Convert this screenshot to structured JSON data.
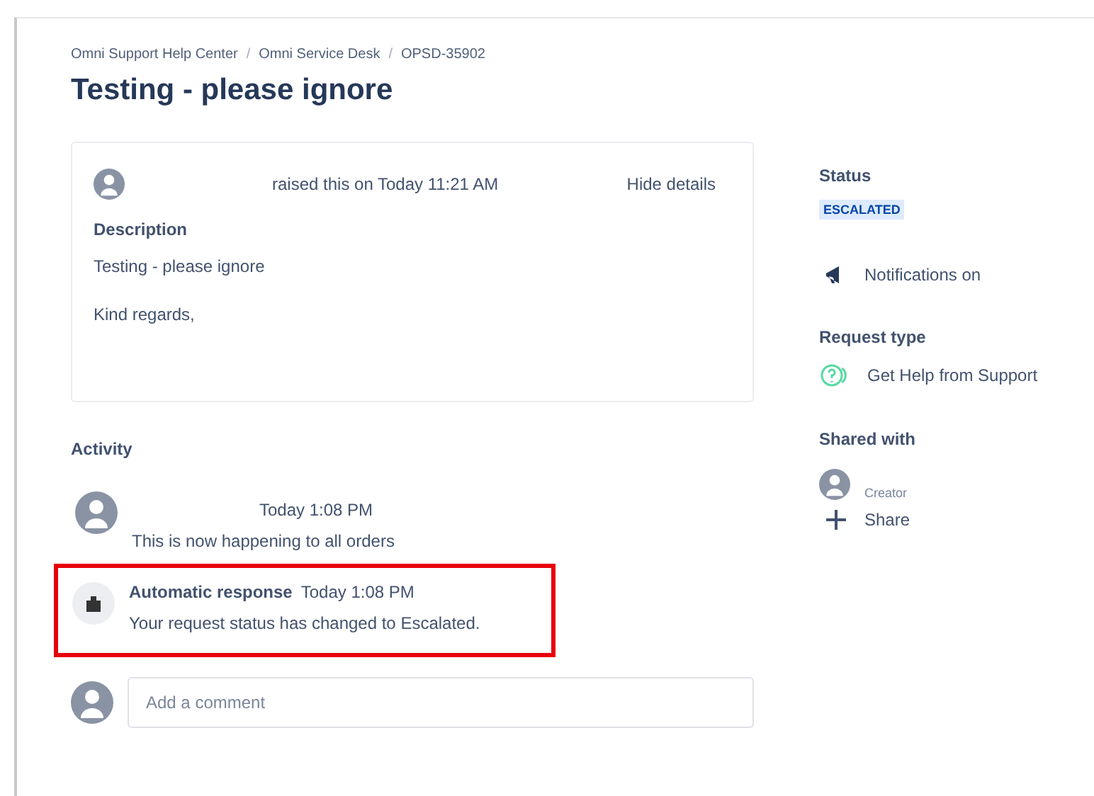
{
  "breadcrumbs": [
    "Omni Support Help Center",
    "Omni Service Desk",
    "OPSD-35902"
  ],
  "breadcrumb_separators": [
    "/",
    "/"
  ],
  "title": "Testing - please ignore",
  "request": {
    "raised": "raised this on Today 11:21 AM",
    "toggle": "Hide details",
    "description_label": "Description",
    "description": [
      "Testing - please ignore",
      "Kind regards,"
    ]
  },
  "activity": {
    "heading": "Activity",
    "items": [
      {
        "kind": "user",
        "time": "Today 1:08 PM",
        "text": "This is now happening to all orders",
        "highlighted": false
      },
      {
        "kind": "automatic",
        "author": "Automatic response",
        "time": "Today 1:08 PM",
        "text": "Your request status has changed to Escalated.",
        "highlighted": true
      }
    ],
    "comment": {
      "placeholder": "Add a comment"
    }
  },
  "sidebar": {
    "status_label": "Status",
    "status": "ESCALATED",
    "notifications": "Notifications on",
    "request_type_label": "Request type",
    "request_type": "Get Help from Support",
    "shared_label": "Shared with",
    "shared": [
      {
        "role": "Creator"
      }
    ],
    "share": "Share"
  }
}
